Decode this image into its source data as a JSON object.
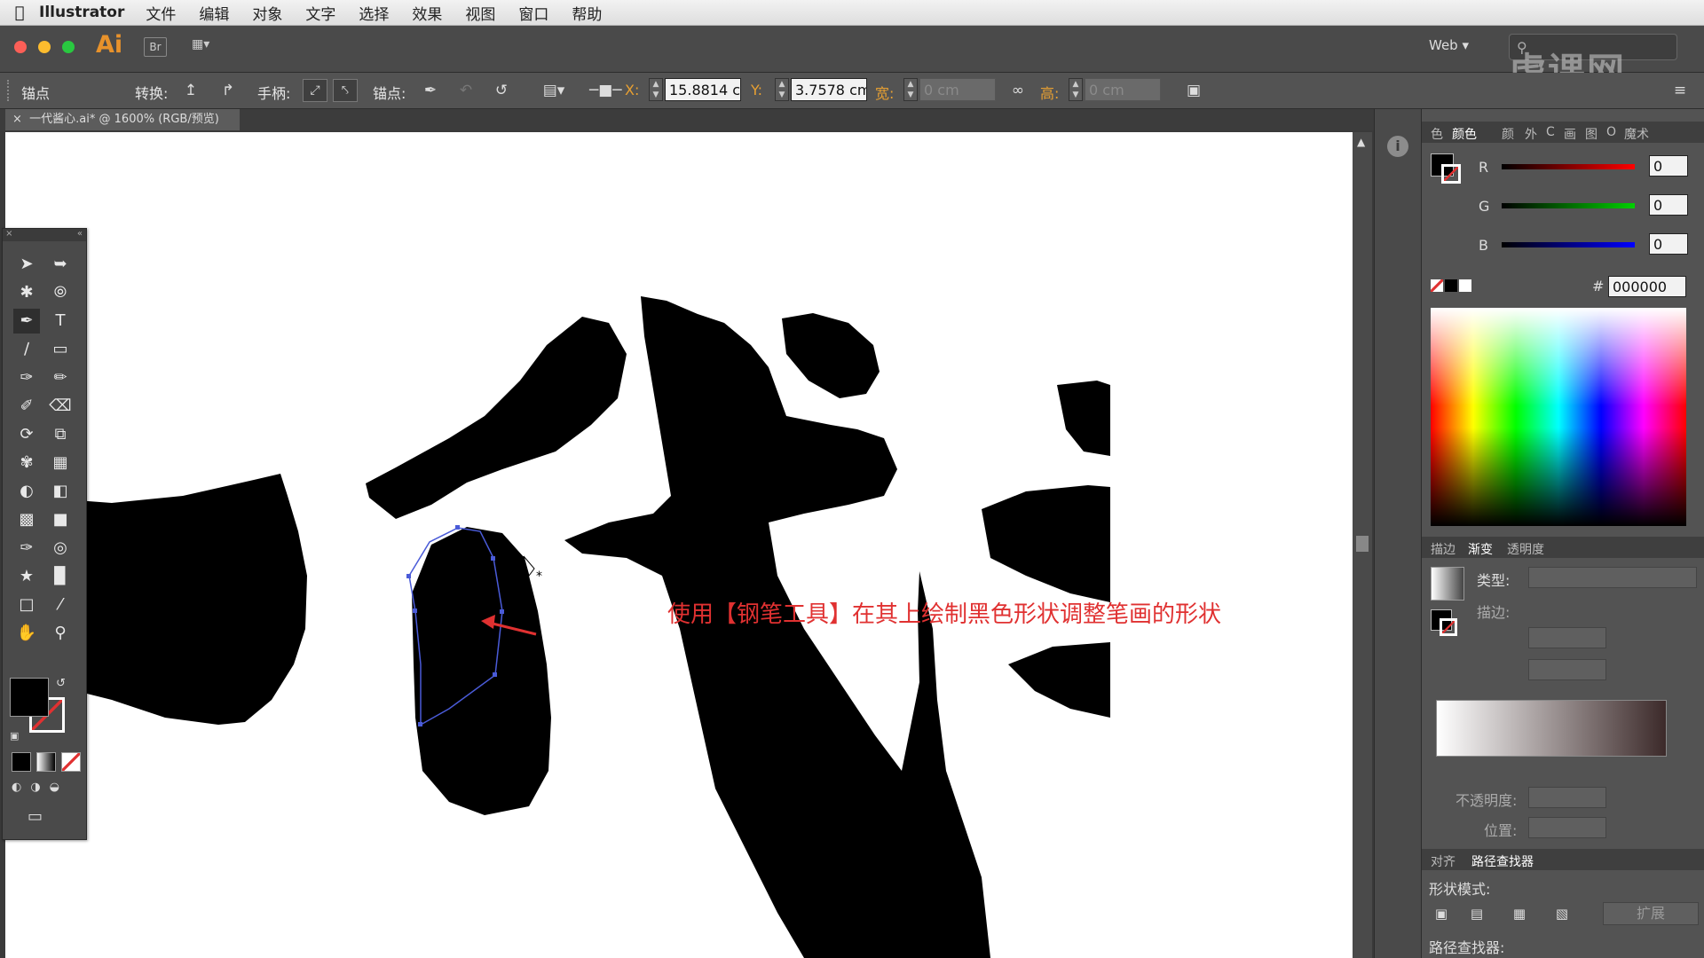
{
  "menubar": {
    "app_name": "Illustrator",
    "items": [
      "文件",
      "编辑",
      "对象",
      "文字",
      "选择",
      "效果",
      "视图",
      "窗口",
      "帮助"
    ]
  },
  "appbar": {
    "logo": "Ai",
    "bridge": "Br",
    "workspace": "Web",
    "watermark": "虎课网"
  },
  "control_bar": {
    "mode_label": "锚点",
    "convert_label": "转换:",
    "handle_label": "手柄:",
    "anchor_label": "锚点:",
    "x_label": "X:",
    "x_value": "15.8814 c",
    "y_label": "Y:",
    "y_value": "3.7578 cm",
    "w_label": "宽:",
    "w_value": "0 cm",
    "h_label": "高:",
    "h_value": "0 cm"
  },
  "document": {
    "tab_title": "一代酱心.ai* @ 1600% (RGB/预览)"
  },
  "annotation": {
    "text": "使用【钢笔工具】在其上绘制黑色形状调整笔画的形状"
  },
  "color_panel": {
    "tabs": [
      "色",
      "颜色",
      "颜",
      "外",
      "C",
      "画",
      "图",
      "O",
      "魔术"
    ],
    "r_label": "R",
    "r_value": "0",
    "g_label": "G",
    "g_value": "0",
    "b_label": "B",
    "b_value": "0",
    "hex_label": "#",
    "hex_value": "000000"
  },
  "gradient_panel": {
    "tabs": [
      "描边",
      "渐变",
      "透明度"
    ],
    "type_label": "类型:",
    "stroke_label": "描边:",
    "opacity_label": "不透明度:",
    "position_label": "位置:"
  },
  "pathfinder_panel": {
    "tabs": [
      "对齐",
      "路径查找器"
    ],
    "shape_modes_label": "形状模式:",
    "expand_label": "扩展",
    "pathfinders_label": "路径查找器:"
  },
  "colors": {
    "accent_orange": "#e8922b",
    "annotation_red": "#e03131",
    "path_blue": "#4a5bd8"
  }
}
